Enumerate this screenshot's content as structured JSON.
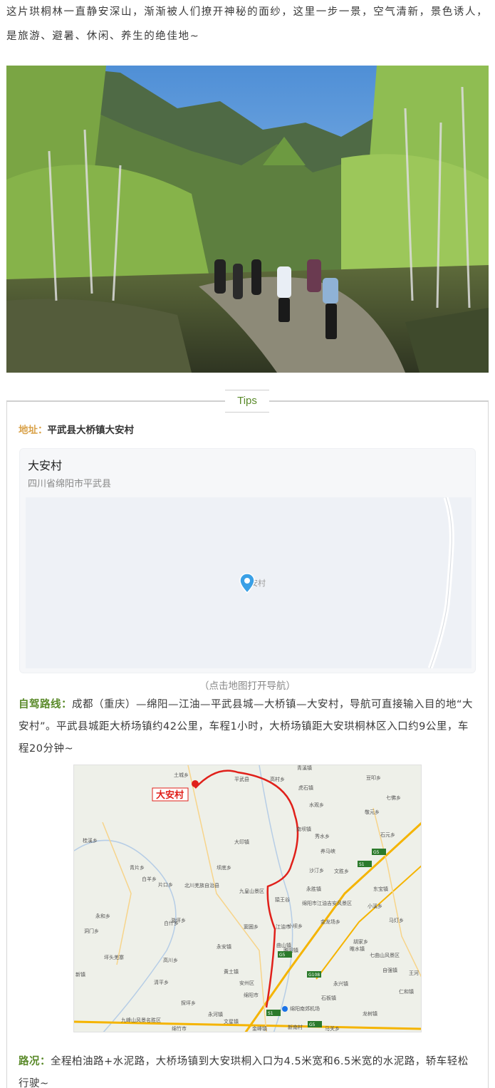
{
  "intro": {
    "text": "这片珙桐林一直静安深山，渐渐被人们撩开神秘的面纱，这里一步一景，空气清新，景色诱人，是旅游、避暑、休闲、养生的绝佳地~"
  },
  "tips": {
    "title": "Tips"
  },
  "address": {
    "label": "地址：",
    "value": "平武县大桥镇大安村"
  },
  "map_card": {
    "name": "大安村",
    "region": "四川省绵阳市平武县",
    "pin_label": "大安村",
    "hint": "（点击地图打开导航）"
  },
  "route": {
    "label": "自驾路线：",
    "text": "成都（重庆）—绵阳—江油—平武县城—大桥镇—大安村，导航可直接输入目的地“大安村”。平武县城距大桥场镇约42公里，车程1小时，大桥场镇距大安珙桐林区入口约9公里，车程20分钟~"
  },
  "road_map": {
    "destination": "大安村",
    "places": [
      "土城乡",
      "平武县",
      "高村乡",
      "青溪镇",
      "豆叩乡",
      "虎石镇",
      "水观乡",
      "七佛乡",
      "南坝镇",
      "敬元乡",
      "石元乡",
      "大印镇",
      "养马峡",
      "文胜乡",
      "北川羌族自治县",
      "九皇山景区",
      "猿王谷",
      "永胜镇",
      "绵阳市江油吉安风景区",
      "东宝镇",
      "小溪乡",
      "青片乡",
      "白羊乡",
      "片口乡",
      "桂溪乡",
      "坝底乡",
      "窦圌乡",
      "白什乡",
      "永和乡",
      "洞门乡",
      "坪头羌寨",
      "小坝乡",
      "漩坪乡",
      "江油市",
      "金龙场乡",
      "马灯乡",
      "曲山镇",
      "高川乡",
      "睢水镇",
      "永安镇",
      "雎阳镇",
      "胡家乡",
      "七曲山风景区",
      "新镇",
      "清平乡",
      "黄土镇",
      "永兴镇",
      "安州区",
      "石板镇",
      "仁和镇",
      "自强镇",
      "王河",
      "探坪乡",
      "九峰山风景名胜区",
      "绵阳市",
      "绵阳南郊机场",
      "龙树镇",
      "绵竹市",
      "永河镇",
      "文星镇",
      "金峰镇",
      "新南村",
      "马关乡",
      "秀水乡",
      "沙汀乡"
    ],
    "highways": [
      "G5",
      "S1",
      "G5",
      "G108",
      "S1",
      "G5"
    ]
  },
  "road_condition": {
    "label": "路况：",
    "text": "全程柏油路+水泥路，大桥场镇到大安珙桐入口为4.5米宽和6.5米宽的水泥路，轿车轻松行驶~"
  },
  "colors": {
    "accent_green": "#5a8a2a",
    "accent_orange": "#d9a24a",
    "route_red": "#e0201a"
  }
}
